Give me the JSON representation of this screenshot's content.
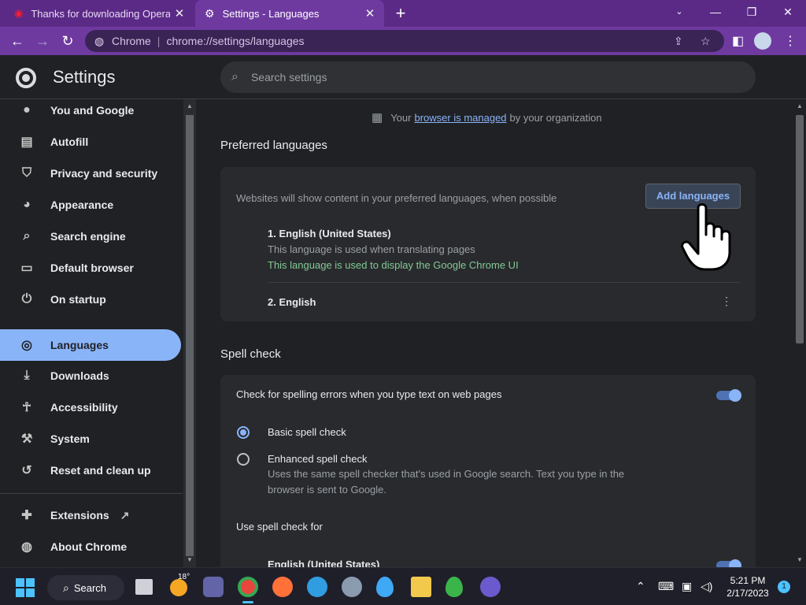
{
  "browser": {
    "tabs": [
      {
        "title": "Thanks for downloading Opera",
        "active": false
      },
      {
        "title": "Settings - Languages",
        "active": true
      }
    ],
    "address": {
      "site_label": "Chrome",
      "url": "chrome://settings/languages"
    },
    "colors": {
      "frame": "#5b2a86",
      "toolbar": "#6e3aa0",
      "accent": "#8ab4f8"
    }
  },
  "header": {
    "title": "Settings",
    "search_placeholder": "Search settings"
  },
  "sidebar": {
    "items": [
      {
        "label": "You and Google",
        "icon": "person-icon"
      },
      {
        "label": "Autofill",
        "icon": "clipboard-icon"
      },
      {
        "label": "Privacy and security",
        "icon": "shield-icon"
      },
      {
        "label": "Appearance",
        "icon": "palette-icon"
      },
      {
        "label": "Search engine",
        "icon": "search-icon"
      },
      {
        "label": "Default browser",
        "icon": "browser-window-icon"
      },
      {
        "label": "On startup",
        "icon": "power-icon"
      },
      {
        "label": "Languages",
        "icon": "globe-icon",
        "selected": true
      },
      {
        "label": "Downloads",
        "icon": "download-icon"
      },
      {
        "label": "Accessibility",
        "icon": "accessibility-icon"
      },
      {
        "label": "System",
        "icon": "wrench-icon"
      },
      {
        "label": "Reset and clean up",
        "icon": "restore-icon"
      },
      {
        "label": "Extensions",
        "icon": "puzzle-icon"
      },
      {
        "label": "About Chrome",
        "icon": "chrome-icon"
      }
    ]
  },
  "managed_notice": {
    "prefix": "Your",
    "link": "browser is managed",
    "suffix": "by your organization"
  },
  "preferred_languages": {
    "title": "Preferred languages",
    "description": "Websites will show content in your preferred languages, when possible",
    "add_button": "Add languages",
    "languages": [
      {
        "name": "1. English (United States)",
        "note": "This language is used when translating pages",
        "ui_note": "This language is used to display the Google Chrome UI"
      },
      {
        "name": "2. English"
      }
    ]
  },
  "spell_check": {
    "title": "Spell check",
    "toggle_label": "Check for spelling errors when you type text on web pages",
    "toggle_on": true,
    "options": [
      {
        "label": "Basic spell check",
        "checked": true
      },
      {
        "label": "Enhanced spell check",
        "checked": false,
        "description": "Uses the same spell checker that's used in Google search. Text you type in the browser is sent to Google."
      }
    ],
    "use_for_label": "Use spell check for",
    "use_for_language": "English (United States)"
  },
  "taskbar": {
    "search_label": "Search",
    "weather_temp": "18°",
    "time": "5:21 PM",
    "date": "2/17/2023",
    "notification_count": "1"
  }
}
